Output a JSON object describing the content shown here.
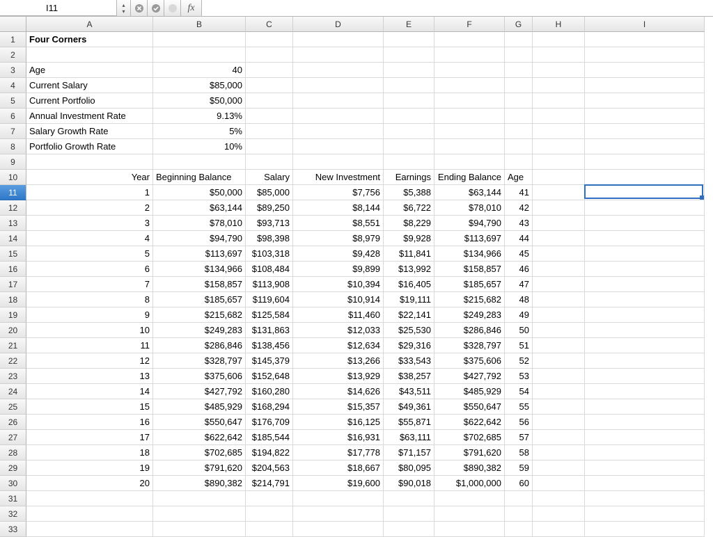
{
  "formula_bar": {
    "cell_ref": "I11",
    "formula": ""
  },
  "columns": [
    "A",
    "B",
    "C",
    "D",
    "E",
    "F",
    "G",
    "H",
    "I"
  ],
  "row_count": 34,
  "selected_row": 11,
  "active_cell": "I11",
  "cells": {
    "A1": {
      "v": "Four Corners",
      "bold": true
    },
    "A3": {
      "v": "Age"
    },
    "B3": {
      "v": "40",
      "r": true
    },
    "A4": {
      "v": "Current Salary"
    },
    "B4": {
      "v": "$85,000",
      "r": true
    },
    "A5": {
      "v": "Current Portfolio"
    },
    "B5": {
      "v": "$50,000",
      "r": true
    },
    "A6": {
      "v": "Annual Investment Rate"
    },
    "B6": {
      "v": "9.13%",
      "r": true
    },
    "A7": {
      "v": "Salary Growth Rate"
    },
    "B7": {
      "v": "5%",
      "r": true
    },
    "A8": {
      "v": "Portfolio Growth Rate"
    },
    "B8": {
      "v": "10%",
      "r": true
    },
    "A10": {
      "v": "Year",
      "r": true
    },
    "B10": {
      "v": "Beginning Balance"
    },
    "C10": {
      "v": "Salary",
      "r": true
    },
    "D10": {
      "v": "New Investment",
      "r": true
    },
    "E10": {
      "v": "Earnings",
      "r": true
    },
    "F10": {
      "v": "Ending Balance",
      "r": true
    },
    "G10": {
      "v": "Age"
    },
    "A11": {
      "v": "1",
      "r": true
    },
    "B11": {
      "v": "$50,000",
      "r": true
    },
    "C11": {
      "v": "$85,000",
      "r": true
    },
    "D11": {
      "v": "$7,756",
      "r": true
    },
    "E11": {
      "v": "$5,388",
      "r": true
    },
    "F11": {
      "v": "$63,144",
      "r": true
    },
    "G11": {
      "v": "41",
      "r": true
    },
    "A12": {
      "v": "2",
      "r": true
    },
    "B12": {
      "v": "$63,144",
      "r": true
    },
    "C12": {
      "v": "$89,250",
      "r": true
    },
    "D12": {
      "v": "$8,144",
      "r": true
    },
    "E12": {
      "v": "$6,722",
      "r": true
    },
    "F12": {
      "v": "$78,010",
      "r": true
    },
    "G12": {
      "v": "42",
      "r": true
    },
    "A13": {
      "v": "3",
      "r": true
    },
    "B13": {
      "v": "$78,010",
      "r": true
    },
    "C13": {
      "v": "$93,713",
      "r": true
    },
    "D13": {
      "v": "$8,551",
      "r": true
    },
    "E13": {
      "v": "$8,229",
      "r": true
    },
    "F13": {
      "v": "$94,790",
      "r": true
    },
    "G13": {
      "v": "43",
      "r": true
    },
    "A14": {
      "v": "4",
      "r": true
    },
    "B14": {
      "v": "$94,790",
      "r": true
    },
    "C14": {
      "v": "$98,398",
      "r": true
    },
    "D14": {
      "v": "$8,979",
      "r": true
    },
    "E14": {
      "v": "$9,928",
      "r": true
    },
    "F14": {
      "v": "$113,697",
      "r": true
    },
    "G14": {
      "v": "44",
      "r": true
    },
    "A15": {
      "v": "5",
      "r": true
    },
    "B15": {
      "v": "$113,697",
      "r": true
    },
    "C15": {
      "v": "$103,318",
      "r": true
    },
    "D15": {
      "v": "$9,428",
      "r": true
    },
    "E15": {
      "v": "$11,841",
      "r": true
    },
    "F15": {
      "v": "$134,966",
      "r": true
    },
    "G15": {
      "v": "45",
      "r": true
    },
    "A16": {
      "v": "6",
      "r": true
    },
    "B16": {
      "v": "$134,966",
      "r": true
    },
    "C16": {
      "v": "$108,484",
      "r": true
    },
    "D16": {
      "v": "$9,899",
      "r": true
    },
    "E16": {
      "v": "$13,992",
      "r": true
    },
    "F16": {
      "v": "$158,857",
      "r": true
    },
    "G16": {
      "v": "46",
      "r": true
    },
    "A17": {
      "v": "7",
      "r": true
    },
    "B17": {
      "v": "$158,857",
      "r": true
    },
    "C17": {
      "v": "$113,908",
      "r": true
    },
    "D17": {
      "v": "$10,394",
      "r": true
    },
    "E17": {
      "v": "$16,405",
      "r": true
    },
    "F17": {
      "v": "$185,657",
      "r": true
    },
    "G17": {
      "v": "47",
      "r": true
    },
    "A18": {
      "v": "8",
      "r": true
    },
    "B18": {
      "v": "$185,657",
      "r": true
    },
    "C18": {
      "v": "$119,604",
      "r": true
    },
    "D18": {
      "v": "$10,914",
      "r": true
    },
    "E18": {
      "v": "$19,111",
      "r": true
    },
    "F18": {
      "v": "$215,682",
      "r": true
    },
    "G18": {
      "v": "48",
      "r": true
    },
    "A19": {
      "v": "9",
      "r": true
    },
    "B19": {
      "v": "$215,682",
      "r": true
    },
    "C19": {
      "v": "$125,584",
      "r": true
    },
    "D19": {
      "v": "$11,460",
      "r": true
    },
    "E19": {
      "v": "$22,141",
      "r": true
    },
    "F19": {
      "v": "$249,283",
      "r": true
    },
    "G19": {
      "v": "49",
      "r": true
    },
    "A20": {
      "v": "10",
      "r": true
    },
    "B20": {
      "v": "$249,283",
      "r": true
    },
    "C20": {
      "v": "$131,863",
      "r": true
    },
    "D20": {
      "v": "$12,033",
      "r": true
    },
    "E20": {
      "v": "$25,530",
      "r": true
    },
    "F20": {
      "v": "$286,846",
      "r": true
    },
    "G20": {
      "v": "50",
      "r": true
    },
    "A21": {
      "v": "11",
      "r": true
    },
    "B21": {
      "v": "$286,846",
      "r": true
    },
    "C21": {
      "v": "$138,456",
      "r": true
    },
    "D21": {
      "v": "$12,634",
      "r": true
    },
    "E21": {
      "v": "$29,316",
      "r": true
    },
    "F21": {
      "v": "$328,797",
      "r": true
    },
    "G21": {
      "v": "51",
      "r": true
    },
    "A22": {
      "v": "12",
      "r": true
    },
    "B22": {
      "v": "$328,797",
      "r": true
    },
    "C22": {
      "v": "$145,379",
      "r": true
    },
    "D22": {
      "v": "$13,266",
      "r": true
    },
    "E22": {
      "v": "$33,543",
      "r": true
    },
    "F22": {
      "v": "$375,606",
      "r": true
    },
    "G22": {
      "v": "52",
      "r": true
    },
    "A23": {
      "v": "13",
      "r": true
    },
    "B23": {
      "v": "$375,606",
      "r": true
    },
    "C23": {
      "v": "$152,648",
      "r": true
    },
    "D23": {
      "v": "$13,929",
      "r": true
    },
    "E23": {
      "v": "$38,257",
      "r": true
    },
    "F23": {
      "v": "$427,792",
      "r": true
    },
    "G23": {
      "v": "53",
      "r": true
    },
    "A24": {
      "v": "14",
      "r": true
    },
    "B24": {
      "v": "$427,792",
      "r": true
    },
    "C24": {
      "v": "$160,280",
      "r": true
    },
    "D24": {
      "v": "$14,626",
      "r": true
    },
    "E24": {
      "v": "$43,511",
      "r": true
    },
    "F24": {
      "v": "$485,929",
      "r": true
    },
    "G24": {
      "v": "54",
      "r": true
    },
    "A25": {
      "v": "15",
      "r": true
    },
    "B25": {
      "v": "$485,929",
      "r": true
    },
    "C25": {
      "v": "$168,294",
      "r": true
    },
    "D25": {
      "v": "$15,357",
      "r": true
    },
    "E25": {
      "v": "$49,361",
      "r": true
    },
    "F25": {
      "v": "$550,647",
      "r": true
    },
    "G25": {
      "v": "55",
      "r": true
    },
    "A26": {
      "v": "16",
      "r": true
    },
    "B26": {
      "v": "$550,647",
      "r": true
    },
    "C26": {
      "v": "$176,709",
      "r": true
    },
    "D26": {
      "v": "$16,125",
      "r": true
    },
    "E26": {
      "v": "$55,871",
      "r": true
    },
    "F26": {
      "v": "$622,642",
      "r": true
    },
    "G26": {
      "v": "56",
      "r": true
    },
    "A27": {
      "v": "17",
      "r": true
    },
    "B27": {
      "v": "$622,642",
      "r": true
    },
    "C27": {
      "v": "$185,544",
      "r": true
    },
    "D27": {
      "v": "$16,931",
      "r": true
    },
    "E27": {
      "v": "$63,111",
      "r": true
    },
    "F27": {
      "v": "$702,685",
      "r": true
    },
    "G27": {
      "v": "57",
      "r": true
    },
    "A28": {
      "v": "18",
      "r": true
    },
    "B28": {
      "v": "$702,685",
      "r": true
    },
    "C28": {
      "v": "$194,822",
      "r": true
    },
    "D28": {
      "v": "$17,778",
      "r": true
    },
    "E28": {
      "v": "$71,157",
      "r": true
    },
    "F28": {
      "v": "$791,620",
      "r": true
    },
    "G28": {
      "v": "58",
      "r": true
    },
    "A29": {
      "v": "19",
      "r": true
    },
    "B29": {
      "v": "$791,620",
      "r": true
    },
    "C29": {
      "v": "$204,563",
      "r": true
    },
    "D29": {
      "v": "$18,667",
      "r": true
    },
    "E29": {
      "v": "$80,095",
      "r": true
    },
    "F29": {
      "v": "$890,382",
      "r": true
    },
    "G29": {
      "v": "59",
      "r": true
    },
    "A30": {
      "v": "20",
      "r": true
    },
    "B30": {
      "v": "$890,382",
      "r": true
    },
    "C30": {
      "v": "$214,791",
      "r": true
    },
    "D30": {
      "v": "$19,600",
      "r": true
    },
    "E30": {
      "v": "$90,018",
      "r": true
    },
    "F30": {
      "v": "$1,000,000",
      "r": true
    },
    "G30": {
      "v": "60",
      "r": true
    }
  }
}
